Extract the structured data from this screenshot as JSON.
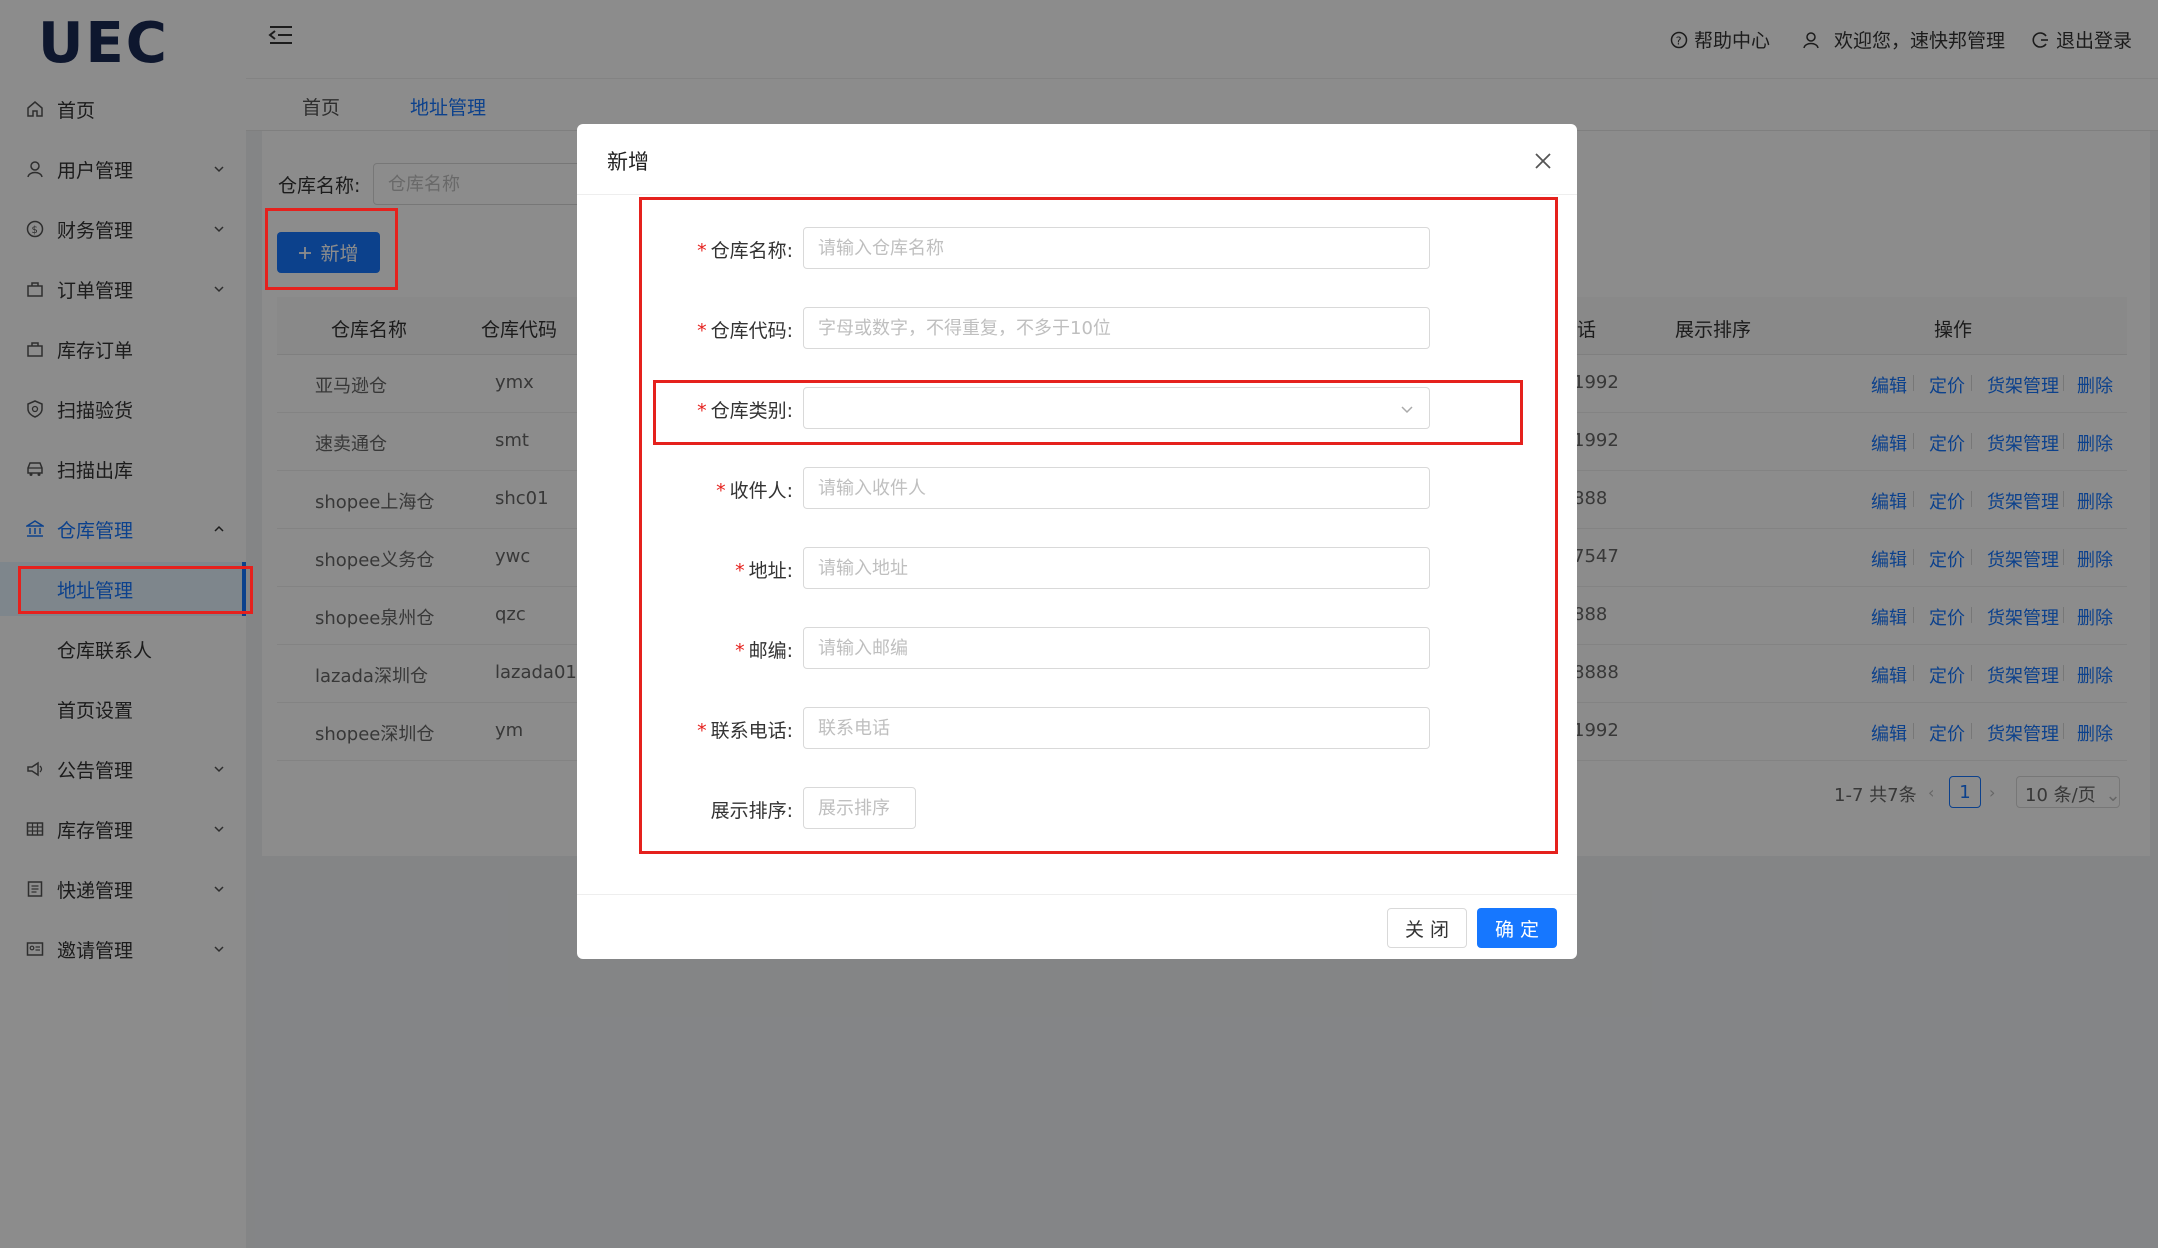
{
  "brand": {
    "logo_text": "UEC"
  },
  "header": {
    "help": "帮助中心",
    "welcome": "欢迎您，速快邦管理",
    "logout": "退出登录"
  },
  "sidebar": {
    "items": [
      {
        "label": "首页",
        "icon": "home-icon"
      },
      {
        "label": "用户管理",
        "icon": "user-icon"
      },
      {
        "label": "财务管理",
        "icon": "finance-icon"
      },
      {
        "label": "订单管理",
        "icon": "bag-icon"
      },
      {
        "label": "库存订单",
        "icon": "bag-icon"
      },
      {
        "label": "扫描验货",
        "icon": "scan-icon"
      },
      {
        "label": "扫描出库",
        "icon": "car-icon"
      },
      {
        "label": "仓库管理",
        "icon": "bank-icon"
      },
      {
        "label": "公告管理",
        "icon": "sound-icon"
      },
      {
        "label": "库存管理",
        "icon": "table-icon"
      },
      {
        "label": "快递管理",
        "icon": "list-icon"
      },
      {
        "label": "邀请管理",
        "icon": "card-icon"
      }
    ],
    "sub_items": [
      {
        "label": "地址管理"
      },
      {
        "label": "仓库联系人"
      },
      {
        "label": "首页设置"
      }
    ]
  },
  "tabs": [
    {
      "label": "首页"
    },
    {
      "label": "地址管理"
    }
  ],
  "search": {
    "label": "仓库名称:",
    "placeholder": "仓库名称"
  },
  "toolbar": {
    "add_label": "新增"
  },
  "table": {
    "headers": {
      "name": "仓库名称",
      "code": "仓库代码",
      "phone": "话",
      "sort": "展示排序",
      "ops": "操作"
    },
    "rows": [
      {
        "name": "亚马逊仓",
        "code": "ymx",
        "phone": "1992"
      },
      {
        "name": "速卖通仓",
        "code": "smt",
        "phone": "1992"
      },
      {
        "name": "shopee上海仓",
        "code": "shc01",
        "phone": "888"
      },
      {
        "name": "shopee义务仓",
        "code": "ywc",
        "phone": "7547"
      },
      {
        "name": "shopee泉州仓",
        "code": "qzc",
        "phone": "888"
      },
      {
        "name": "lazada深圳仓",
        "code": "lazada01",
        "phone": "8888"
      },
      {
        "name": "shopee深圳仓",
        "code": "ym",
        "phone": "1992"
      }
    ],
    "ops": {
      "edit": "编辑",
      "price": "定价",
      "shelf": "货架管理",
      "delete": "删除"
    }
  },
  "pager": {
    "total": "1-7 共7条",
    "page": "1",
    "size": "10 条/页"
  },
  "modal": {
    "title": "新增",
    "fields": {
      "name": {
        "label": "仓库名称:",
        "placeholder": "请输入仓库名称"
      },
      "code": {
        "label": "仓库代码:",
        "placeholder": "字母或数字，不得重复，不多于10位"
      },
      "category": {
        "label": "仓库类别:",
        "value": ""
      },
      "receiver": {
        "label": "收件人:",
        "placeholder": "请输入收件人"
      },
      "address": {
        "label": "地址:",
        "placeholder": "请输入地址"
      },
      "zip": {
        "label": "邮编:",
        "placeholder": "请输入邮编"
      },
      "phone": {
        "label": "联系电话:",
        "placeholder": "联系电话"
      },
      "sort": {
        "label": "展示排序:",
        "placeholder": "展示排序"
      }
    },
    "cancel_label": "关 闭",
    "ok_label": "确 定"
  },
  "colors": {
    "primary": "#1677ff",
    "highlight": "#e5211d",
    "overlay": "#000000"
  }
}
